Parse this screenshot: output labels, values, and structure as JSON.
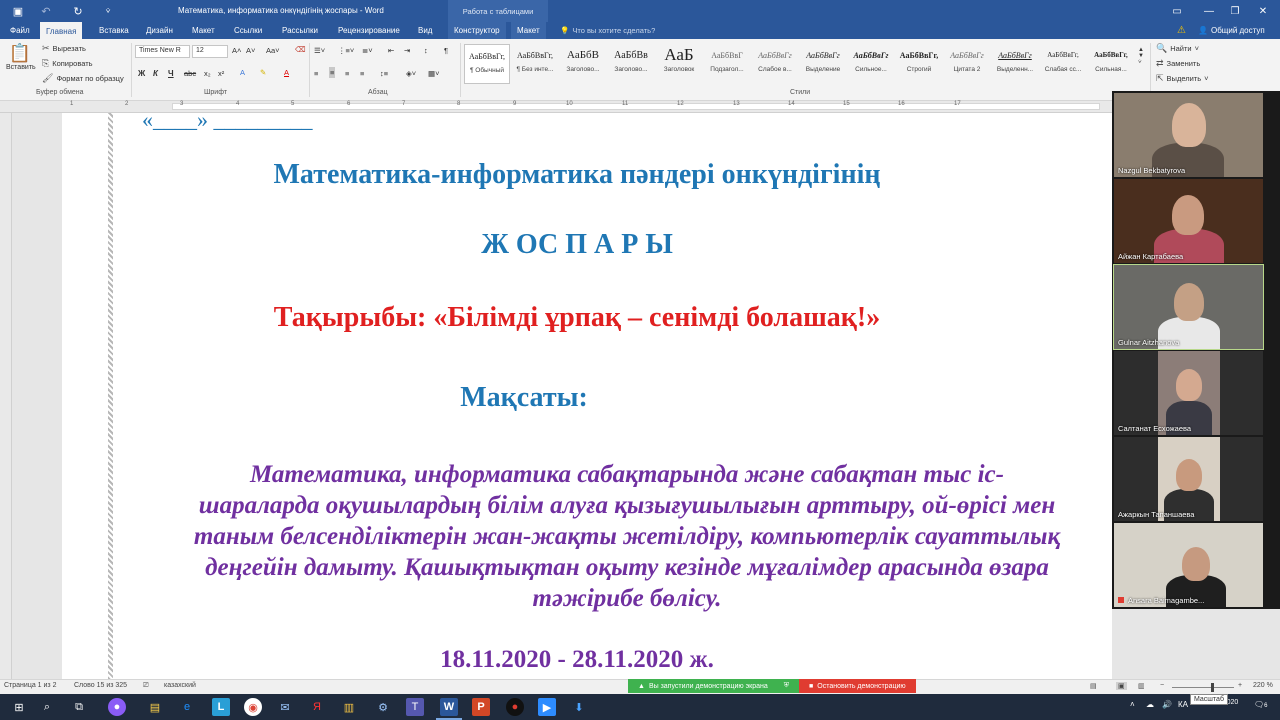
{
  "titlebar": {
    "document_title": "Математика, информатика онкүндігінің жоспары - Word",
    "context_group": "Работа с таблицами"
  },
  "tabs": [
    {
      "label": "Файл"
    },
    {
      "label": "Главная"
    },
    {
      "label": "Вставка"
    },
    {
      "label": "Дизайн"
    },
    {
      "label": "Макет"
    },
    {
      "label": "Ссылки"
    },
    {
      "label": "Рассылки"
    },
    {
      "label": "Рецензирование"
    },
    {
      "label": "Вид"
    },
    {
      "label": "Конструктор"
    },
    {
      "label": "Макет"
    }
  ],
  "tellme": "Что вы хотите сделать?",
  "share": "Общий доступ",
  "clipboard": {
    "paste": "Вставить",
    "cut": "Вырезать",
    "copy": "Копировать",
    "format_painter": "Формат по образцу",
    "label": "Буфер обмена"
  },
  "font": {
    "family": "Times New R",
    "size": "12",
    "label": "Шрифт",
    "bold": "Ж",
    "italic": "К",
    "underline": "Ч"
  },
  "paragraph": {
    "label": "Абзац"
  },
  "styles": {
    "label": "Стили",
    "items": [
      {
        "sample": "АаБбВвГг,",
        "name": "¶ Обычный"
      },
      {
        "sample": "АаБбВвГг,",
        "name": "¶ Без инте..."
      },
      {
        "sample": "АаБбВ",
        "name": "Заголово..."
      },
      {
        "sample": "АаБбВв",
        "name": "Заголово..."
      },
      {
        "sample": "АаБ",
        "name": "Заголовок"
      },
      {
        "sample": "АаБбВвГ",
        "name": "Подзагол..."
      },
      {
        "sample": "АаБбВвГг",
        "name": "Слабое в..."
      },
      {
        "sample": "АаБбВвГг",
        "name": "Выделение"
      },
      {
        "sample": "АаБбВвГг",
        "name": "Сильное..."
      },
      {
        "sample": "АаБбВвГг,",
        "name": "Строгий"
      },
      {
        "sample": "АаБбВвГг",
        "name": "Цитата 2"
      },
      {
        "sample": "АаБбВвГг",
        "name": "Выделенн..."
      },
      {
        "sample": "АаБбВвГг,",
        "name": "Слабая сс..."
      },
      {
        "sample": "АаБбВвГг,",
        "name": "Сильная..."
      }
    ]
  },
  "editing": {
    "find": "Найти",
    "replace": "Заменить",
    "select": "Выделить"
  },
  "ruler_numbers": [
    "1",
    "2",
    "3",
    "4",
    "5",
    "6",
    "7",
    "8",
    "9",
    "10",
    "11",
    "12",
    "13",
    "14",
    "15",
    "16",
    "17"
  ],
  "document": {
    "top_line": "«____» _________",
    "title_line1": "Математика-информатика пәндері онкүндігінің",
    "title_line2": "Ж ОС П А Р Ы",
    "topic": "Тақырыбы:   «Білімді ұрпақ – сенімді болашақ!»",
    "goal_heading": "Мақсаты:",
    "goal_lines": [
      "Математика, информатика  сабақтарында және сабақтан тыс іс-",
      "шараларда оқушылардың білім алуға қызығушылығын арттыру, ой-өрісі мен",
      "таным белсенділіктерін жан-жақты жетілдіру, компьютерлік сауаттылық",
      "деңгейін дамыту. Қашықтықтан оқыту кезінде мұғалімдер арасында өзара",
      "тәжірибе бөлісу."
    ],
    "dates": "18.11.2020 - 28.11.2020 ж.",
    "colors": {
      "blue": "#1f77b4",
      "red": "#e02020",
      "purple": "#7030a0"
    }
  },
  "participants": [
    {
      "name": "Nazgul Bekbatyrova"
    },
    {
      "name": "Айжан Картабаева"
    },
    {
      "name": "Gulnar Aitzhanova"
    },
    {
      "name": "Салтанат Есхожаева"
    },
    {
      "name": "Ажаркын Тапаншаева"
    },
    {
      "name": "Ansara Baimagambe..."
    }
  ],
  "statusbar": {
    "page": "Страница 1 из 2",
    "words": "Слово 15 из 325",
    "language": "казахский",
    "zoom": "220 %"
  },
  "share_status": {
    "running": "Вы запустили демонстрацию экрана",
    "stop": "Остановить демонстрацию"
  },
  "tooltip": "Масштаб",
  "taskbar": {
    "time": "",
    "date": "20.11.2020",
    "notifications": "6"
  }
}
